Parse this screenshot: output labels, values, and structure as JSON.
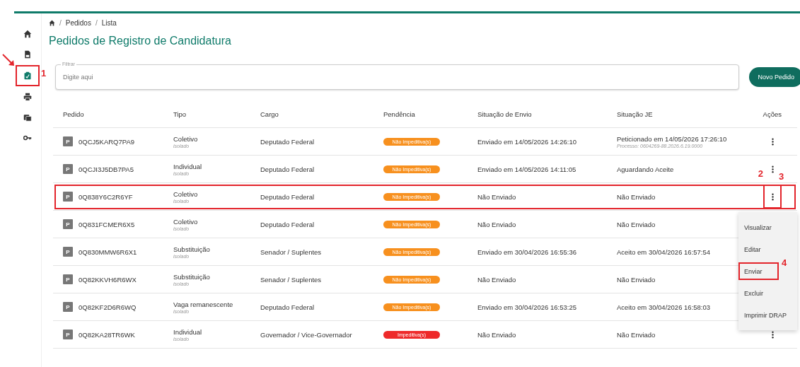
{
  "sidebar": {
    "items": [
      {
        "kind": "home",
        "selected": false,
        "highlighted": false
      },
      {
        "kind": "document",
        "selected": false,
        "highlighted": false
      },
      {
        "kind": "clipboard",
        "selected": true,
        "highlighted": true,
        "arrow": true,
        "callout": "1"
      },
      {
        "kind": "printer",
        "selected": false,
        "highlighted": false
      },
      {
        "kind": "stack",
        "selected": false,
        "highlighted": false
      },
      {
        "kind": "key",
        "selected": false,
        "highlighted": false
      }
    ]
  },
  "breadcrumb": [
    "Pedidos",
    "Lista"
  ],
  "breadcrumb_separator": "/",
  "title": "Pedidos de Registro de Candidatura",
  "filter": {
    "label": "Filtrar",
    "placeholder": "Digite aqui"
  },
  "new_button": "Novo Pedido",
  "table": {
    "columns": [
      "Pedido",
      "Tipo",
      "Cargo",
      "Pendência",
      "Situação de Envio",
      "Situação JE",
      "Ações"
    ],
    "rows": [
      {
        "badge": "P",
        "pedido": "0QCJ5KARQ7PA9",
        "tipo": "Coletivo",
        "subtipo": "isolado",
        "cargo": "Deputado Federal",
        "pendencia": {
          "kind": "warning",
          "label": "Não Impeditiva(s)"
        },
        "envio": "Enviado em 14/05/2026 14:26:10",
        "je": "Peticionado em 14/05/2026 17:26:10",
        "je_note": "Processo: 0604269-88.2026.6.19.0000",
        "highlighted": false,
        "action_highlighted": false
      },
      {
        "badge": "P",
        "pedido": "0QCJI3J5DB7PA5",
        "tipo": "Individual",
        "subtipo": "isolado",
        "cargo": "Deputado Federal",
        "pendencia": {
          "kind": "warning",
          "label": "Não Impeditiva(s)"
        },
        "envio": "Enviado em 14/05/2026 14:11:05",
        "je": "Aguardando Aceite",
        "highlighted": false,
        "action_highlighted": false
      },
      {
        "badge": "P",
        "pedido": "0Q838Y6C2R6YF",
        "tipo": "Coletivo",
        "subtipo": "isolado",
        "cargo": "Deputado Federal",
        "pendencia": {
          "kind": "warning",
          "label": "Não Impeditiva(s)"
        },
        "envio": "Não Enviado",
        "je": "Não Enviado",
        "highlighted": true,
        "callout": "2",
        "action_highlighted": true,
        "action_callout": "3"
      },
      {
        "badge": "P",
        "pedido": "0Q831FCMER6X5",
        "tipo": "Coletivo",
        "subtipo": "isolado",
        "cargo": "Deputado Federal",
        "pendencia": {
          "kind": "warning",
          "label": "Não Impeditiva(s)"
        },
        "envio": "Não Enviado",
        "je": "Não Enviado",
        "highlighted": false
      },
      {
        "badge": "P",
        "pedido": "0Q830MMW6R6X1",
        "tipo": "Substituição",
        "subtipo": "isolado",
        "cargo": "Senador / Suplentes",
        "pendencia": {
          "kind": "warning",
          "label": "Não Impeditiva(s)"
        },
        "envio": "Enviado em 30/04/2026 16:55:36",
        "je": "Aceito em 30/04/2026 16:57:54",
        "highlighted": false
      },
      {
        "badge": "P",
        "pedido": "0Q82KKVH6R6WX",
        "tipo": "Substituição",
        "subtipo": "isolado",
        "cargo": "Senador / Suplentes",
        "pendencia": {
          "kind": "warning",
          "label": "Não Impeditiva(s)"
        },
        "envio": "Não Enviado",
        "je": "Não Enviado",
        "highlighted": false
      },
      {
        "badge": "P",
        "pedido": "0Q82KF2D6R6WQ",
        "tipo": "Vaga remanescente",
        "subtipo": "isolado",
        "cargo": "Deputado Federal",
        "pendencia": {
          "kind": "warning",
          "label": "Não Impeditiva(s)"
        },
        "envio": "Enviado em 30/04/2026 16:53:25",
        "je": "Aceito em 30/04/2026 16:58:03",
        "highlighted": false
      },
      {
        "badge": "P",
        "pedido": "0Q82KA28TR6WK",
        "tipo": "Individual",
        "subtipo": "isolado",
        "cargo": "Governador / Vice-Governador",
        "pendencia": {
          "kind": "blocking",
          "label": "Impeditiva(s)"
        },
        "envio": "Não Enviado",
        "je": "Não Enviado",
        "highlighted": false,
        "action_highlighted": false
      }
    ]
  },
  "action_menu": {
    "items": [
      {
        "label": "Visualizar",
        "highlighted": false
      },
      {
        "label": "Editar",
        "highlighted": false
      },
      {
        "label": "Enviar",
        "highlighted": true,
        "callout": "4"
      },
      {
        "label": "Excluir",
        "highlighted": false
      },
      {
        "label": "Imprimir DRAP",
        "highlighted": false
      }
    ]
  }
}
